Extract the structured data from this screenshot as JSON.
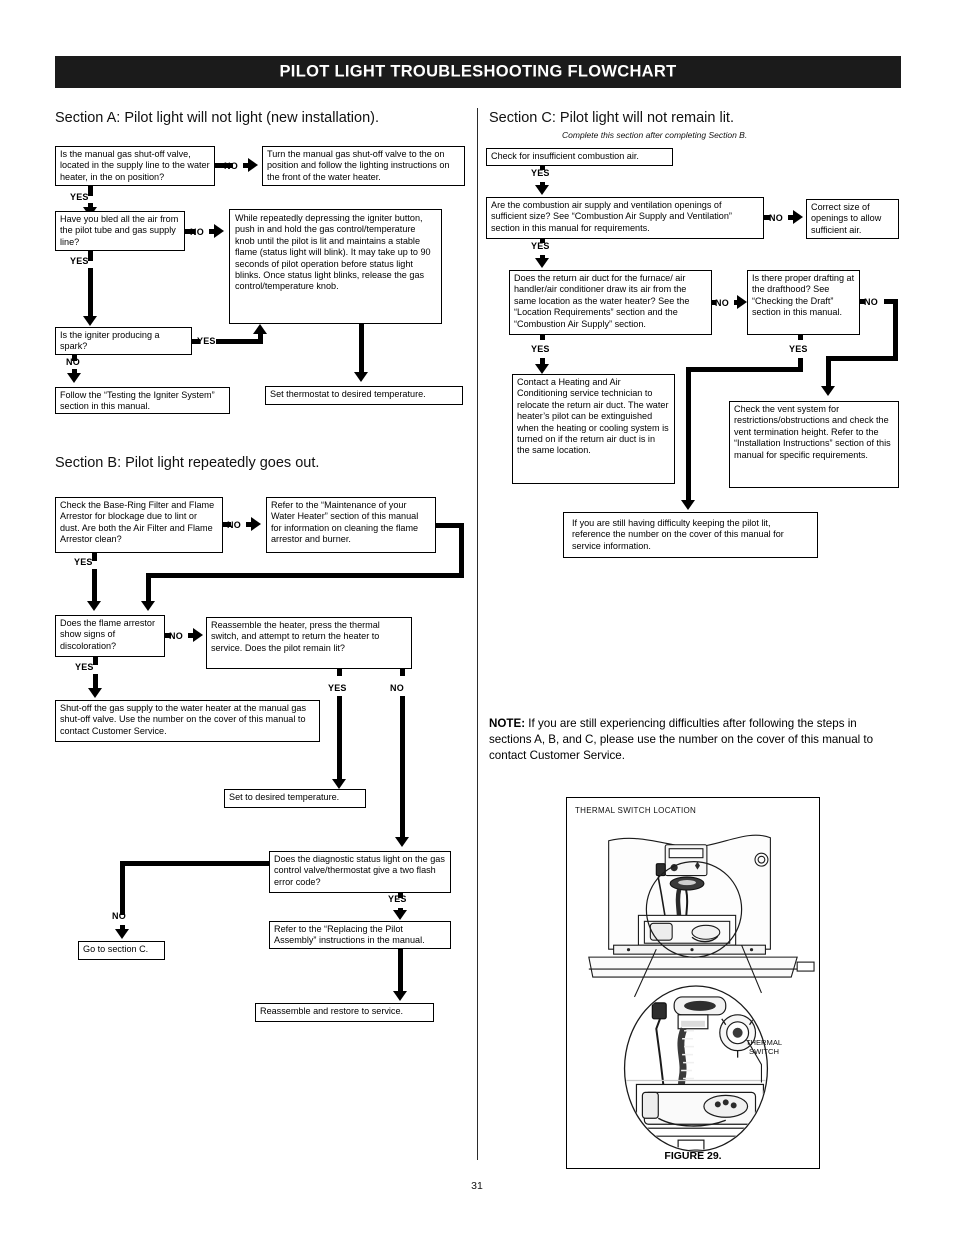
{
  "header": {
    "title": "PILOT LIGHT TROUBLESHOOTING FLOWCHART"
  },
  "page_number": "31",
  "sections": {
    "a": {
      "heading": "Section A: Pilot light will not light (new installation).",
      "boxes": {
        "shutoff_valve": "Is the manual gas shut-off valve, located in the supply line to the water heater, in the on position?",
        "turn_valve_on": "Turn the manual gas shut-off valve to the on position and follow the lighting instructions on the front of the water heater.",
        "bled_air": "Have you bled all the air from the pilot tube and gas supply line?",
        "depress_igniter": "While repeatedly depressing the igniter button, push in and hold the gas control/temperature knob until the pilot is lit and maintains a stable flame (status light will blink).  It may take up to 90 seconds of pilot operation before status light blinks. Once status light blinks, release the gas control/temperature knob.",
        "igniter_spark": "Is the igniter producing a spark?",
        "testing_igniter": "Follow the “Testing the Igniter System” section in this manual.",
        "set_thermostat": "Set thermostat to desired temperature."
      },
      "labels": {
        "yes": "YES",
        "no": "NO"
      }
    },
    "b": {
      "heading": "Section B: Pilot light repeatedly goes out.",
      "boxes": {
        "check_filter": "Check the Base-Ring Filter and Flame Arrestor for blockage due to lint or dust. Are both the Air Filter and Flame Arrestor clean?",
        "maintenance_ref": "Refer to the “Maintenance of your Water Heater” section of this manual for information on cleaning the flame arrestor and burner.",
        "discoloration": "Does the flame arrestor show signs of discoloration?",
        "reassemble_press": "Reassemble the heater, press the thermal switch, and attempt to return the heater to service. Does the pilot remain lit?",
        "shutoff_contact": "Shut-off the gas supply to the water heater at the manual gas shut-off valve.  Use the number on the cover of this manual to contact Customer Service.",
        "set_desired": "Set to desired temperature.",
        "two_flash": "Does the diagnostic status light on the gas control valve/thermostat give a two flash error code?",
        "goto_section_c": "Go to section C.",
        "replacing_pilot": "Refer to the “Replacing the Pilot Assembly” instructions in the manual.",
        "reassemble_restore": "Reassemble and restore to service."
      },
      "labels": {
        "yes": "YES",
        "no": "NO"
      }
    },
    "c": {
      "heading": "Section C: Pilot light will not remain lit.",
      "subheading": "Complete this section after completing Section B.",
      "boxes": {
        "check_combustion": "Check for insufficient combustion air.",
        "openings_size": "Are the combustion air supply and ventilation openings of sufficient size? See “Combustion Air Supply and Ventilation” section in this manual for requirements.",
        "correct_size": "Correct size of openings to allow sufficient air.",
        "return_duct": "Does the return air duct for the furnace/ air handler/air conditioner draw its air from the same location as the water heater? See the “Location Requirements” section and the “Combustion Air Supply” section.",
        "proper_drafting": "Is there proper drafting at the drafthood?  See “Checking the Draft” section in this manual.",
        "contact_hvac": "Contact a Heating and Air Conditioning service technician to relocate the return air duct. The water heater’s pilot can be extinguished when the heating or cooling system is turned on if the return air duct is in the same location.",
        "check_vent": "Check the vent system for restrictions/obstructions and check the vent termination height. Refer to the “Installation Instructions” section of this manual for specific requirements.",
        "still_difficulty": "If you are still having difficulty keeping the pilot lit, reference the number on the cover of this manual for service information."
      },
      "labels": {
        "yes": "YES",
        "no": "NO"
      }
    }
  },
  "note": {
    "label": "NOTE:",
    "text": " If you are still experiencing difficulties after following the steps in sections A, B, and C,  please use the number on the cover of this manual to contact Customer Service."
  },
  "figure": {
    "title": "THERMAL SWITCH LOCATION",
    "caption": "FIGURE 29.",
    "callout": "THERMAL\nSWITCH",
    "callout_line1": "THERMAL",
    "callout_line2": "SWITCH"
  },
  "colors": {
    "header_bg": "#1b1b1b",
    "header_text": "#ffffff",
    "line": "#000000"
  }
}
